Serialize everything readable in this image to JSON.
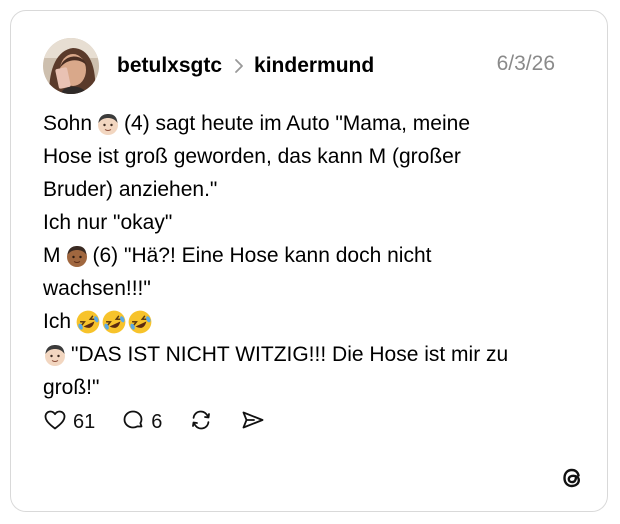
{
  "post": {
    "author": "betulxsgtc",
    "community": "kindermund",
    "date": "6/3/26",
    "lines": [
      {
        "before": "Sohn",
        "after": "(4) sagt heute im Auto \"Mama, meine"
      },
      {
        "text": "Hose ist groß geworden, das kann M (großer"
      },
      {
        "text": "Bruder) anziehen.\""
      },
      {
        "text": "Ich nur \"okay\""
      },
      {
        "before": "M",
        "after": "(6) \"Hä?! Eine Hose kann doch nicht"
      },
      {
        "text": "wachsen!!!\""
      },
      {
        "before": "Ich"
      },
      {
        "after": "\"DAS IST NICHT WITZIG!!! Die Hose ist mir zu"
      },
      {
        "text": "groß!\""
      }
    ],
    "emojis": {
      "line1": "boy-light-skin-emoji",
      "line5": "boy-medium-dark-skin-emoji",
      "line7": "rolling-on-floor-laughing-emoji x3",
      "line8": "boy-light-skin-emoji"
    }
  },
  "actions": {
    "likes": "61",
    "replies": "6"
  },
  "icons": [
    "heart-icon",
    "comment-icon",
    "repost-icon",
    "share-icon",
    "threads-logo-icon",
    "chevron-right-icon"
  ],
  "colors": {
    "date": "#8a8a8a",
    "border": "#d9d9d9",
    "text": "#000000"
  }
}
